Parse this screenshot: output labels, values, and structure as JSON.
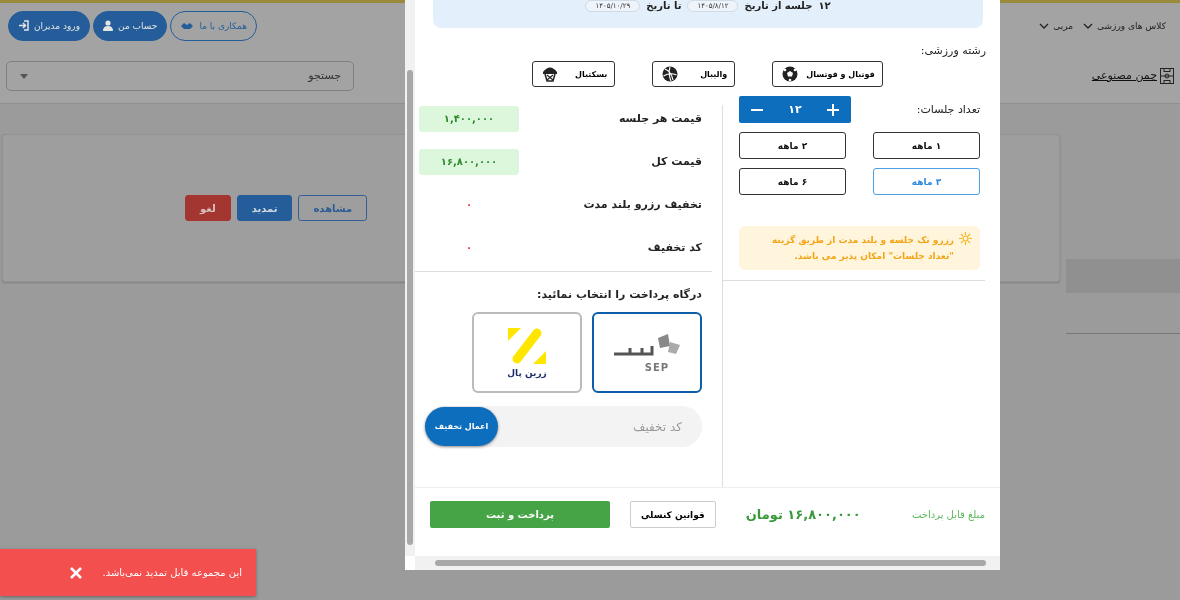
{
  "header": {
    "buttons": [
      {
        "label": "همکاری با ما",
        "kind": "partner"
      },
      {
        "label": "حساب من",
        "kind": "account"
      },
      {
        "label": "ورود مدیران",
        "kind": "login"
      }
    ],
    "nav": [
      {
        "label": "کلاس های ورزشی",
        "expandable": true
      },
      {
        "label": "مربی",
        "expandable": true
      }
    ]
  },
  "search": {
    "placeholder": "جستجو"
  },
  "category": "چمن مصنوعی",
  "card": {
    "buttons": [
      {
        "label": "مشاهده",
        "kind": "outline"
      },
      {
        "label": "تمدید",
        "kind": "primary"
      },
      {
        "label": "لغو",
        "kind": "danger"
      }
    ]
  },
  "modal": {
    "summary": {
      "count": "۱۲",
      "count_text": "جلسه از تاریخ",
      "from": "۱۴۰۵/۸/۱۲",
      "to_label": "تا تاریخ",
      "to": "۱۴۰۵/۱۰/۲۹"
    },
    "sport_label": "رشته ورزشی:",
    "sports": [
      {
        "label": "فوتبال و فوتسال",
        "kind": "football",
        "selected": false
      },
      {
        "label": "والیبال",
        "kind": "volleyball",
        "selected": false
      },
      {
        "label": "بسکتبال",
        "kind": "basketball",
        "selected": false
      }
    ],
    "sessions": {
      "label": "تعداد جلسات:",
      "value": "۱۲"
    },
    "periods": [
      {
        "label": "۱ ماهه",
        "selected": false
      },
      {
        "label": "۲ ماهه",
        "selected": false
      },
      {
        "label": "۳ ماهه",
        "selected": true
      },
      {
        "label": "۶ ماهه",
        "selected": false
      }
    ],
    "notice": "رزرو تک جلسه و بلند مدت از طریق گزینه \"تعداد جلسات\" امکان پذیر می باشد.",
    "prices": [
      {
        "label": "قیمت هر جلسه",
        "value": "۱,۴۰۰,۰۰۰",
        "kind": "badge"
      },
      {
        "label": "قیمت کل",
        "value": "۱۶,۸۰۰,۰۰۰",
        "kind": "badge"
      },
      {
        "label": "تخفیف رزرو بلند مدت",
        "value": "۰",
        "kind": "plain"
      },
      {
        "label": "کد تخفیف",
        "value": "۰",
        "kind": "plain"
      }
    ],
    "gateway_label": "درگاه پرداخت را انتخاب نمائید:",
    "gateways": [
      {
        "kind": "sep",
        "logo_text": "SEP",
        "selected": true
      },
      {
        "kind": "zarinpal",
        "logo_text": "زرین پال",
        "selected": false
      }
    ],
    "discount": {
      "placeholder": "کد تخفیف",
      "button": "اعمال تخفیف"
    },
    "footer": {
      "label": "مبلغ قابل پرداخت",
      "amount": "۱۶,۸۰۰,۰۰۰ تومان",
      "rules_button": "قوانین کنسلی",
      "pay_button": "پرداخت و ثبت"
    }
  },
  "toast": {
    "message": "این مجموعه قابل تمدید نمی‌باشد."
  }
}
